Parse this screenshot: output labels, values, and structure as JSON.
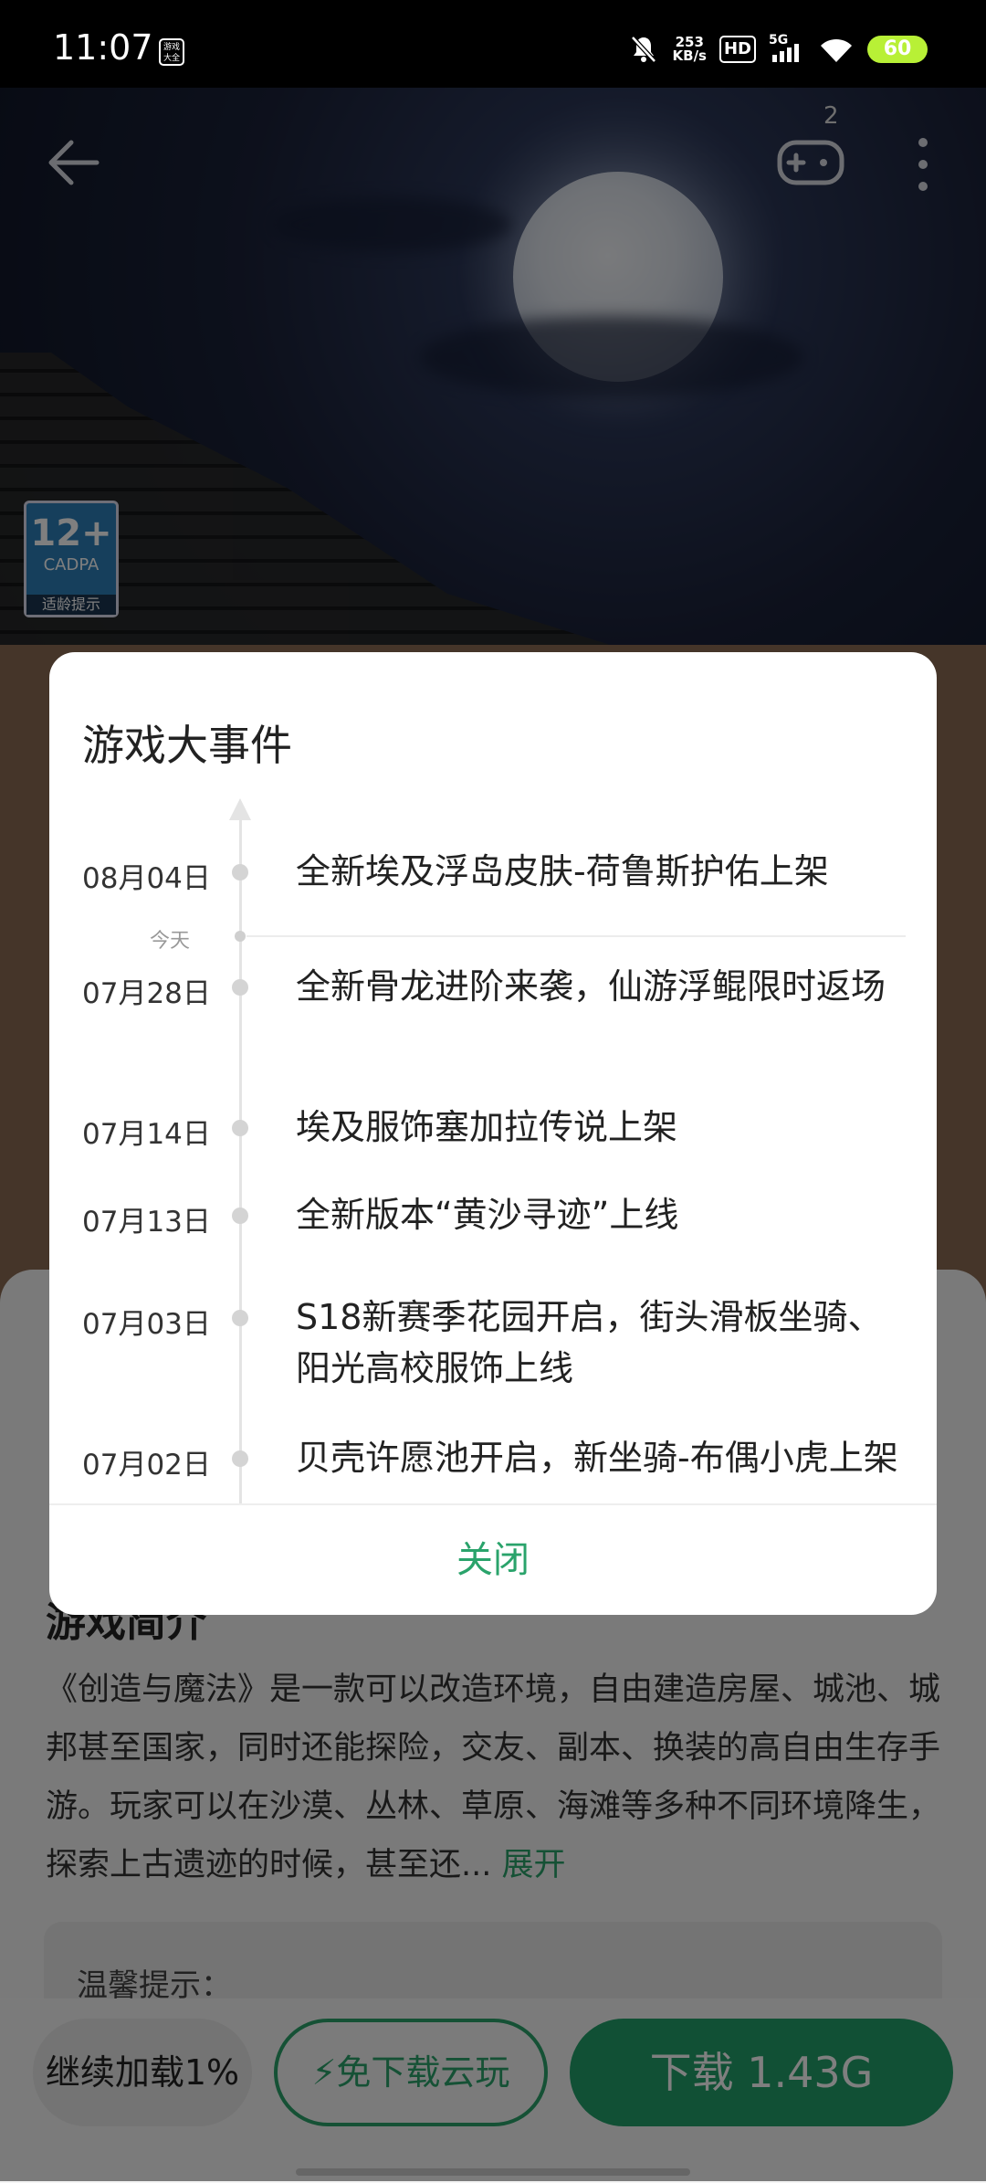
{
  "status_bar": {
    "time": "11:07",
    "app_icon_text": "游戏大全",
    "net_speed_value": "253",
    "net_speed_unit": "KB/s",
    "hd_label": "HD",
    "network_label": "5G",
    "battery": "60"
  },
  "hero": {
    "gamepad_badge_count": "2",
    "age_rating": {
      "age": "12+",
      "org": "CADPA",
      "tip": "适龄提示"
    }
  },
  "background_page": {
    "intro_title": "游戏简介",
    "intro_text": "《创造与魔法》是一款可以改造环境，自由建造房屋、城池、城邦甚至国家，同时还能探险，交友、副本、换装的高自由生存手游。玩家可以在沙漠、丛林、草原、海滩等多种不同环境降生，探索上古遗迹的时候，甚至还...",
    "intro_expand": "展开",
    "tip_title": "温馨提示：",
    "btn_continue": "继续加载1%",
    "btn_cloud": "免下载云玩",
    "btn_download": "下载 1.43G"
  },
  "dialog": {
    "title": "游戏大事件",
    "today_label": "今天",
    "events": [
      {
        "date": "08月04日",
        "text": "全新埃及浮岛皮肤-荷鲁斯护佑上架"
      },
      {
        "date": "07月28日",
        "text": "全新骨龙进阶来袭，仙游浮鲲限时返场"
      },
      {
        "date": "07月14日",
        "text": "埃及服饰塞加拉传说上架"
      },
      {
        "date": "07月13日",
        "text": "全新版本“黄沙寻迹”上线"
      },
      {
        "date": "07月03日",
        "text": "S18新赛季花园开启，街头滑板坐骑、阳光高校服饰上线"
      },
      {
        "date": "07月02日",
        "text": "贝壳许愿池开启，新坐骑-布偶小虎上架"
      }
    ],
    "close_label": "关闭"
  },
  "colors": {
    "accent_green": "#2aa36b",
    "download_green": "#22a06a",
    "battery_green": "#b8f036"
  }
}
